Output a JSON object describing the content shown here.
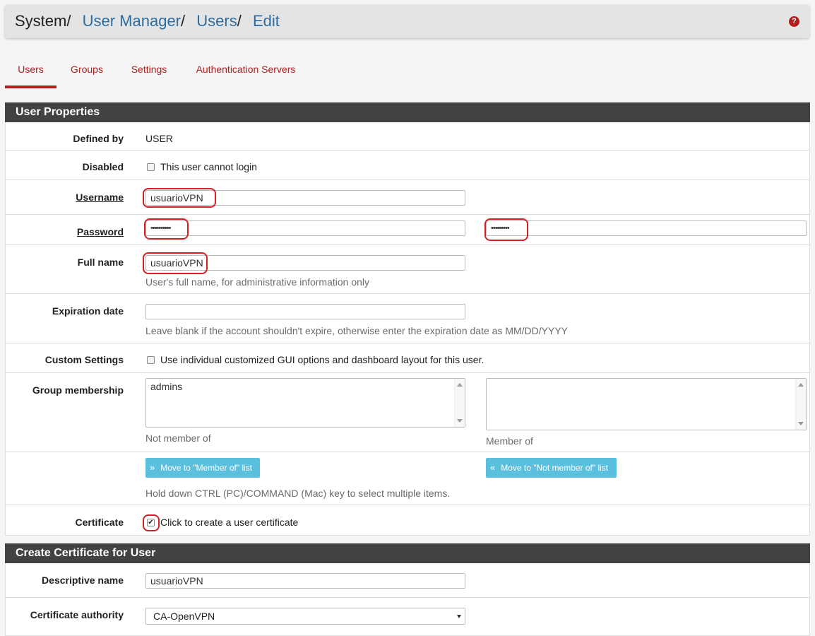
{
  "breadcrumb": {
    "root": "System",
    "items": [
      "User Manager",
      "Users",
      "Edit"
    ]
  },
  "help_icon": "question-circle-icon",
  "tabs": [
    {
      "label": "Users",
      "active": true
    },
    {
      "label": "Groups",
      "active": false
    },
    {
      "label": "Settings",
      "active": false
    },
    {
      "label": "Authentication Servers",
      "active": false
    }
  ],
  "user_properties": {
    "title": "User Properties",
    "defined_by": {
      "label": "Defined by",
      "value": "USER"
    },
    "disabled": {
      "label": "Disabled",
      "checkbox_label": "This user cannot login",
      "checked": false
    },
    "username": {
      "label": "Username",
      "value": "usuarioVPN"
    },
    "password": {
      "label": "Password",
      "value": "••••••••••",
      "confirm_value": "•••••••••"
    },
    "full_name": {
      "label": "Full name",
      "value": "usuarioVPN",
      "hint": "User's full name, for administrative information only"
    },
    "expiration": {
      "label": "Expiration date",
      "value": "",
      "hint": "Leave blank if the account shouldn't expire, otherwise enter the expiration date as MM/DD/YYYY"
    },
    "custom_settings": {
      "label": "Custom Settings",
      "checkbox_label": "Use individual customized GUI options and dashboard layout for this user.",
      "checked": false
    },
    "group_membership": {
      "label": "Group membership",
      "not_member_items": [
        "admins"
      ],
      "member_items": [],
      "not_member_caption": "Not member of",
      "member_caption": "Member of"
    },
    "move_buttons": {
      "to_member": "Move to \"Member of\" list",
      "to_not_member": "Move to \"Not member of\" list",
      "hint": "Hold down CTRL (PC)/COMMAND (Mac) key to select multiple items."
    },
    "certificate": {
      "label": "Certificate",
      "checkbox_label": "Click to create a user certificate",
      "checked": true
    }
  },
  "create_certificate": {
    "title": "Create Certificate for User",
    "descriptive_name": {
      "label": "Descriptive name",
      "value": "usuarioVPN"
    },
    "certificate_authority": {
      "label": "Certificate authority",
      "value": "CA-OpenVPN"
    }
  },
  "colors": {
    "accent": "#b71c1c",
    "link": "#2d6ca2",
    "panel_header": "#424242",
    "info_button": "#5bc0de",
    "highlight": "#d32027"
  }
}
